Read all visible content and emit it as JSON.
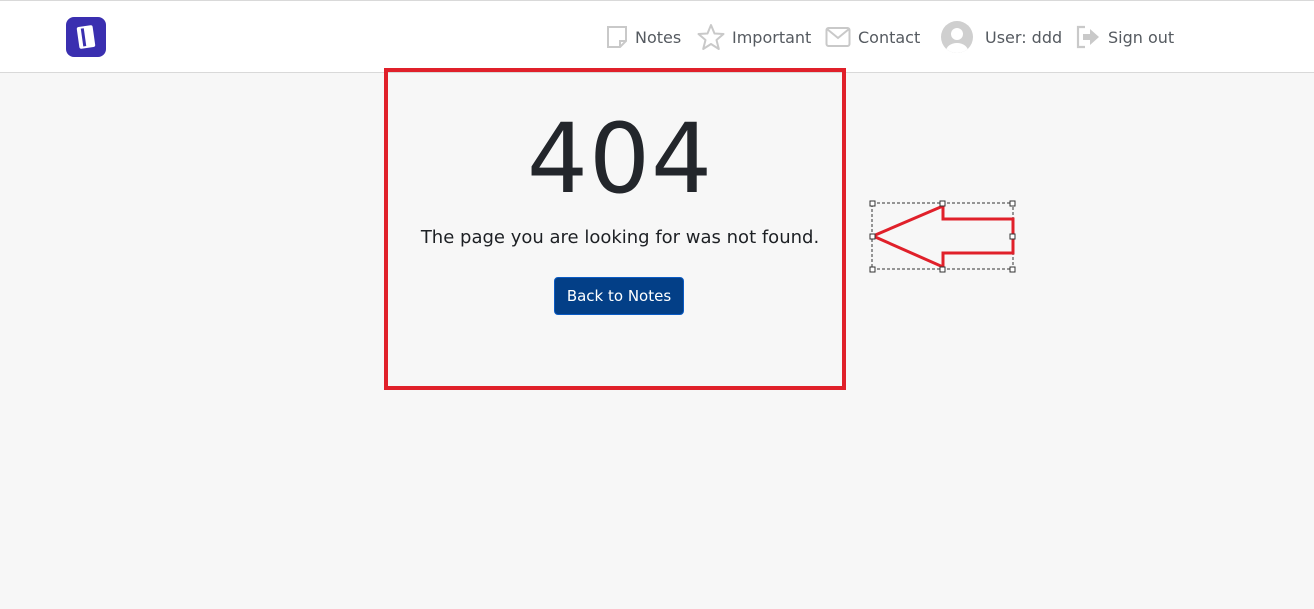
{
  "navbar": {
    "brand_icon": "notebook-app-icon",
    "items": [
      {
        "label": "Notes",
        "icon": "note-icon"
      },
      {
        "label": "Important",
        "icon": "star-icon"
      },
      {
        "label": "Contact",
        "icon": "envelope-icon"
      },
      {
        "label": "User: ddd",
        "icon": "user-avatar-icon"
      },
      {
        "label": "Sign out",
        "icon": "sign-out-icon"
      }
    ]
  },
  "error": {
    "code": "404",
    "message": "The page you are looking for was not found.",
    "back_label": "Back to Notes"
  },
  "annotation": {
    "highlight_color": "#e0202a",
    "arrow_icon": "left-arrow-annotation"
  },
  "colors": {
    "brand": "#3a2fb0",
    "button": "#033f87",
    "background": "#f7f7f7"
  }
}
